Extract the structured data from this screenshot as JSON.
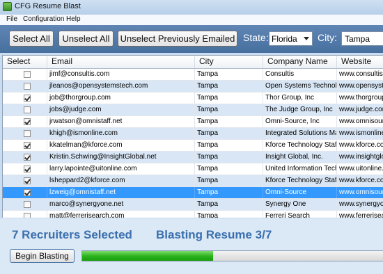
{
  "window": {
    "title": "CFG Resume Blast"
  },
  "menu": [
    "File",
    "Configuration",
    "Help"
  ],
  "toolbar": {
    "select_all": "Select All",
    "unselect_all": "Unselect All",
    "unselect_prev": "Unselect Previously Emailed",
    "state_label": "State:",
    "state_value": "Florida",
    "city_label": "City:",
    "city_value": "Tampa"
  },
  "grid": {
    "columns": [
      "Select",
      "Email",
      "City",
      "Company Name",
      "Website"
    ],
    "rows": [
      {
        "checked": false,
        "email": "jimf@consultis.com",
        "city": "Tampa",
        "company": "Consultis",
        "website": "www.consultis.com"
      },
      {
        "checked": false,
        "email": "jleanos@opensystemstech.com",
        "city": "Tampa",
        "company": "Open Systems Technologies",
        "website": "www.opensystemstech.com"
      },
      {
        "checked": true,
        "email": "job@thorgroup.com",
        "city": "Tampa",
        "company": "Thor Group, Inc",
        "website": "www.thorgroup.com"
      },
      {
        "checked": false,
        "email": "jobs@judge.com",
        "city": "Tampa",
        "company": "The Judge Group, Inc",
        "website": "www.judge.com"
      },
      {
        "checked": true,
        "email": "jrwatson@omnistaff.net",
        "city": "Tampa",
        "company": "Omni-Source, Inc",
        "website": "www.omnisource.net"
      },
      {
        "checked": false,
        "email": "khigh@ismonline.com",
        "city": "Tampa",
        "company": "Integrated Solutions Management",
        "website": "www.ismonline.com"
      },
      {
        "checked": true,
        "email": "kkatelman@kforce.com",
        "city": "Tampa",
        "company": "Kforce Technology Staffing",
        "website": "www.kforce.com"
      },
      {
        "checked": true,
        "email": "Kristin.Schwing@InsightGlobal.net",
        "city": "Tampa",
        "company": "Insight Global, Inc.",
        "website": "www.insightglobal.net"
      },
      {
        "checked": true,
        "email": "larry.lapointe@uitonline.com",
        "city": "Tampa",
        "company": "United Information Technology",
        "website": "www.uitonline.com"
      },
      {
        "checked": true,
        "email": "lsheppard2@kforce.com",
        "city": "Tampa",
        "company": "Kforce Technology Staffing",
        "website": "www.kforce.com"
      },
      {
        "checked": true,
        "email": "lzweig@omnistaff.net",
        "city": "Tampa",
        "company": "Omni-Source",
        "website": "www.omnisource.net",
        "selected": true
      },
      {
        "checked": false,
        "email": "marco@synergyone.net",
        "city": "Tampa",
        "company": "Synergy One",
        "website": "www.synergyone.net"
      },
      {
        "checked": false,
        "email": "matt@ferrerisearch.com",
        "city": "Tampa",
        "company": "Ferreri Search",
        "website": "www.ferrerisearch.com"
      }
    ]
  },
  "status": {
    "recruiters_selected": "7 Recruiters Selected",
    "blasting": "Blasting Resume 3/7",
    "begin_button": "Begin Blasting",
    "progress": 0.43
  },
  "colors": {
    "toolbar": "#4f79aa",
    "accent_text": "#3a6fae",
    "row_alt": "#d8e6f5",
    "row_selected": "#3399ff",
    "progress": "#27b21a"
  }
}
